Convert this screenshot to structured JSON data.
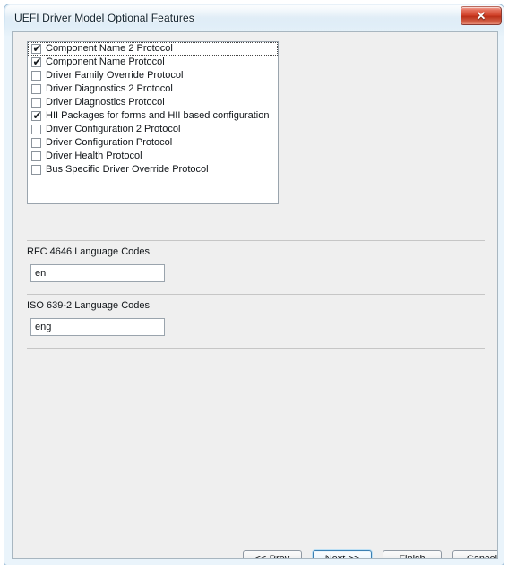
{
  "window": {
    "title": "UEFI Driver Model Optional Features",
    "close_icon": "close-icon",
    "close_glyph": "✕"
  },
  "options": {
    "items": [
      {
        "label": "Component Name 2 Protocol",
        "checked": true,
        "focused": true
      },
      {
        "label": "Component Name Protocol",
        "checked": true,
        "focused": false
      },
      {
        "label": "Driver Family Override Protocol",
        "checked": false,
        "focused": false
      },
      {
        "label": "Driver Diagnostics 2 Protocol",
        "checked": false,
        "focused": false
      },
      {
        "label": "Driver Diagnostics Protocol",
        "checked": false,
        "focused": false
      },
      {
        "label": "HII Packages for forms and HII based configuration",
        "checked": true,
        "focused": false
      },
      {
        "label": "Driver Configuration 2 Protocol",
        "checked": false,
        "focused": false
      },
      {
        "label": "Driver Configuration Protocol",
        "checked": false,
        "focused": false
      },
      {
        "label": "Driver Health Protocol",
        "checked": false,
        "focused": false
      },
      {
        "label": "Bus Specific Driver Override Protocol",
        "checked": false,
        "focused": false
      }
    ],
    "check_glyph": "✔"
  },
  "fields": {
    "rfc": {
      "label": "RFC 4646 Language Codes",
      "value": "en",
      "placeholder": ""
    },
    "iso": {
      "label": "ISO 639-2 Language Codes",
      "value": "eng",
      "placeholder": ""
    }
  },
  "buttons": {
    "prev": "<< Prev",
    "next": "Next >>",
    "finish": "Finish",
    "cancel": "Cancel"
  },
  "colors": {
    "frame_border": "#9fbfd8",
    "client_bg": "#efefef",
    "panel_bg": "#ffffff",
    "separator": "#c6c6c6",
    "close_red": "#cf3f26",
    "default_button_border": "#3c7fb1",
    "text": "#101418"
  }
}
